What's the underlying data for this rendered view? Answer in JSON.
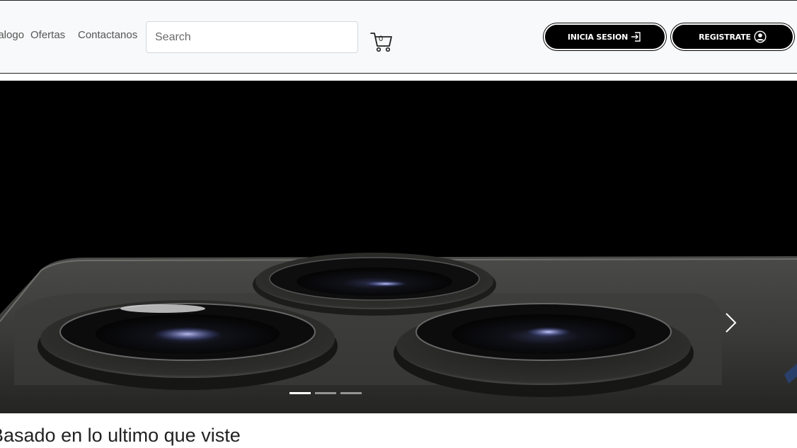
{
  "nav": {
    "links": [
      {
        "label": "Catalogo"
      },
      {
        "label": "Ofertas"
      },
      {
        "label": "Contactanos"
      }
    ],
    "search_placeholder": "Search",
    "cart_count": "0",
    "login_label": "INICIA SESION",
    "register_label": "REGISTRATE"
  },
  "carousel": {
    "slide_count": 3,
    "active_index": 0
  },
  "section": {
    "title": "Basado en lo ultimo que viste"
  },
  "colors": {
    "navbar_bg": "#f8f9fa",
    "button_bg": "#000000",
    "carousel_bg": "#000000"
  },
  "icons": {
    "cart": "cart-icon",
    "login": "sign-in-icon",
    "register": "user-circle-icon",
    "next": "chevron-right-icon"
  }
}
